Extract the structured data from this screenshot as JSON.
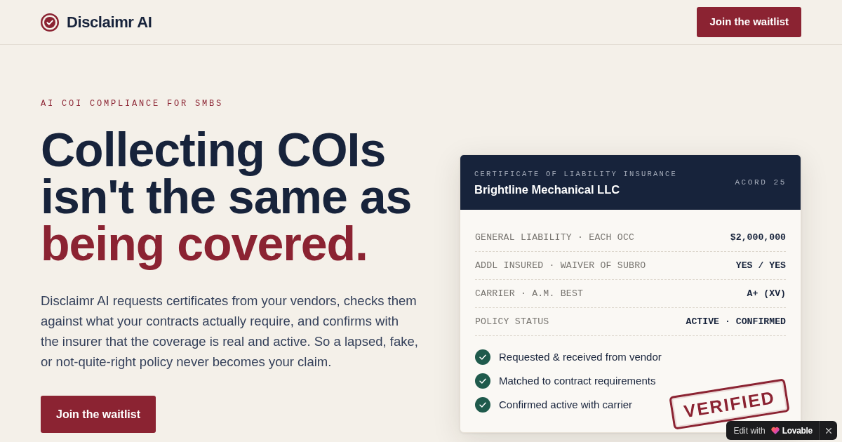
{
  "brand": {
    "name": "Disclaimr AI"
  },
  "nav": {
    "cta": "Join the waitlist"
  },
  "hero": {
    "eyebrow": "AI COI COMPLIANCE FOR SMBS",
    "headline": [
      {
        "text": "Collecting COIs isn't the same as",
        "accent": false
      },
      {
        "text": "being covered.",
        "accent": true
      }
    ],
    "description": "Disclaimr AI requests certificates from your vendors, checks them against what your contracts actually require, and confirms with the insurer that the coverage is real and active. So a lapsed, fake, or not-quite-right policy never becomes your claim.",
    "cta": "Join the waitlist"
  },
  "certificate": {
    "eyebrow": "CERTIFICATE OF LIABILITY INSURANCE",
    "insured": "Brightline Mechanical LLC",
    "form": "ACORD 25",
    "fields": [
      {
        "label": "GENERAL LIABILITY · EACH OCC",
        "value": "$2,000,000"
      },
      {
        "label": "ADDL INSURED · WAIVER OF SUBRO",
        "value": "YES / YES"
      },
      {
        "label": "CARRIER · A.M. BEST",
        "value": "A+ (XV)"
      },
      {
        "label": "POLICY STATUS",
        "value": "ACTIVE · CONFIRMED"
      }
    ],
    "checks": [
      {
        "text": "Requested & received from vendor",
        "checked": true
      },
      {
        "text": "Matched to contract requirements",
        "checked": true
      },
      {
        "text": "Confirmed active with carrier",
        "checked": true
      }
    ],
    "stamp": "VERIFIED"
  },
  "edit_badge": {
    "label": "Edit with",
    "brand": "Lovable"
  }
}
